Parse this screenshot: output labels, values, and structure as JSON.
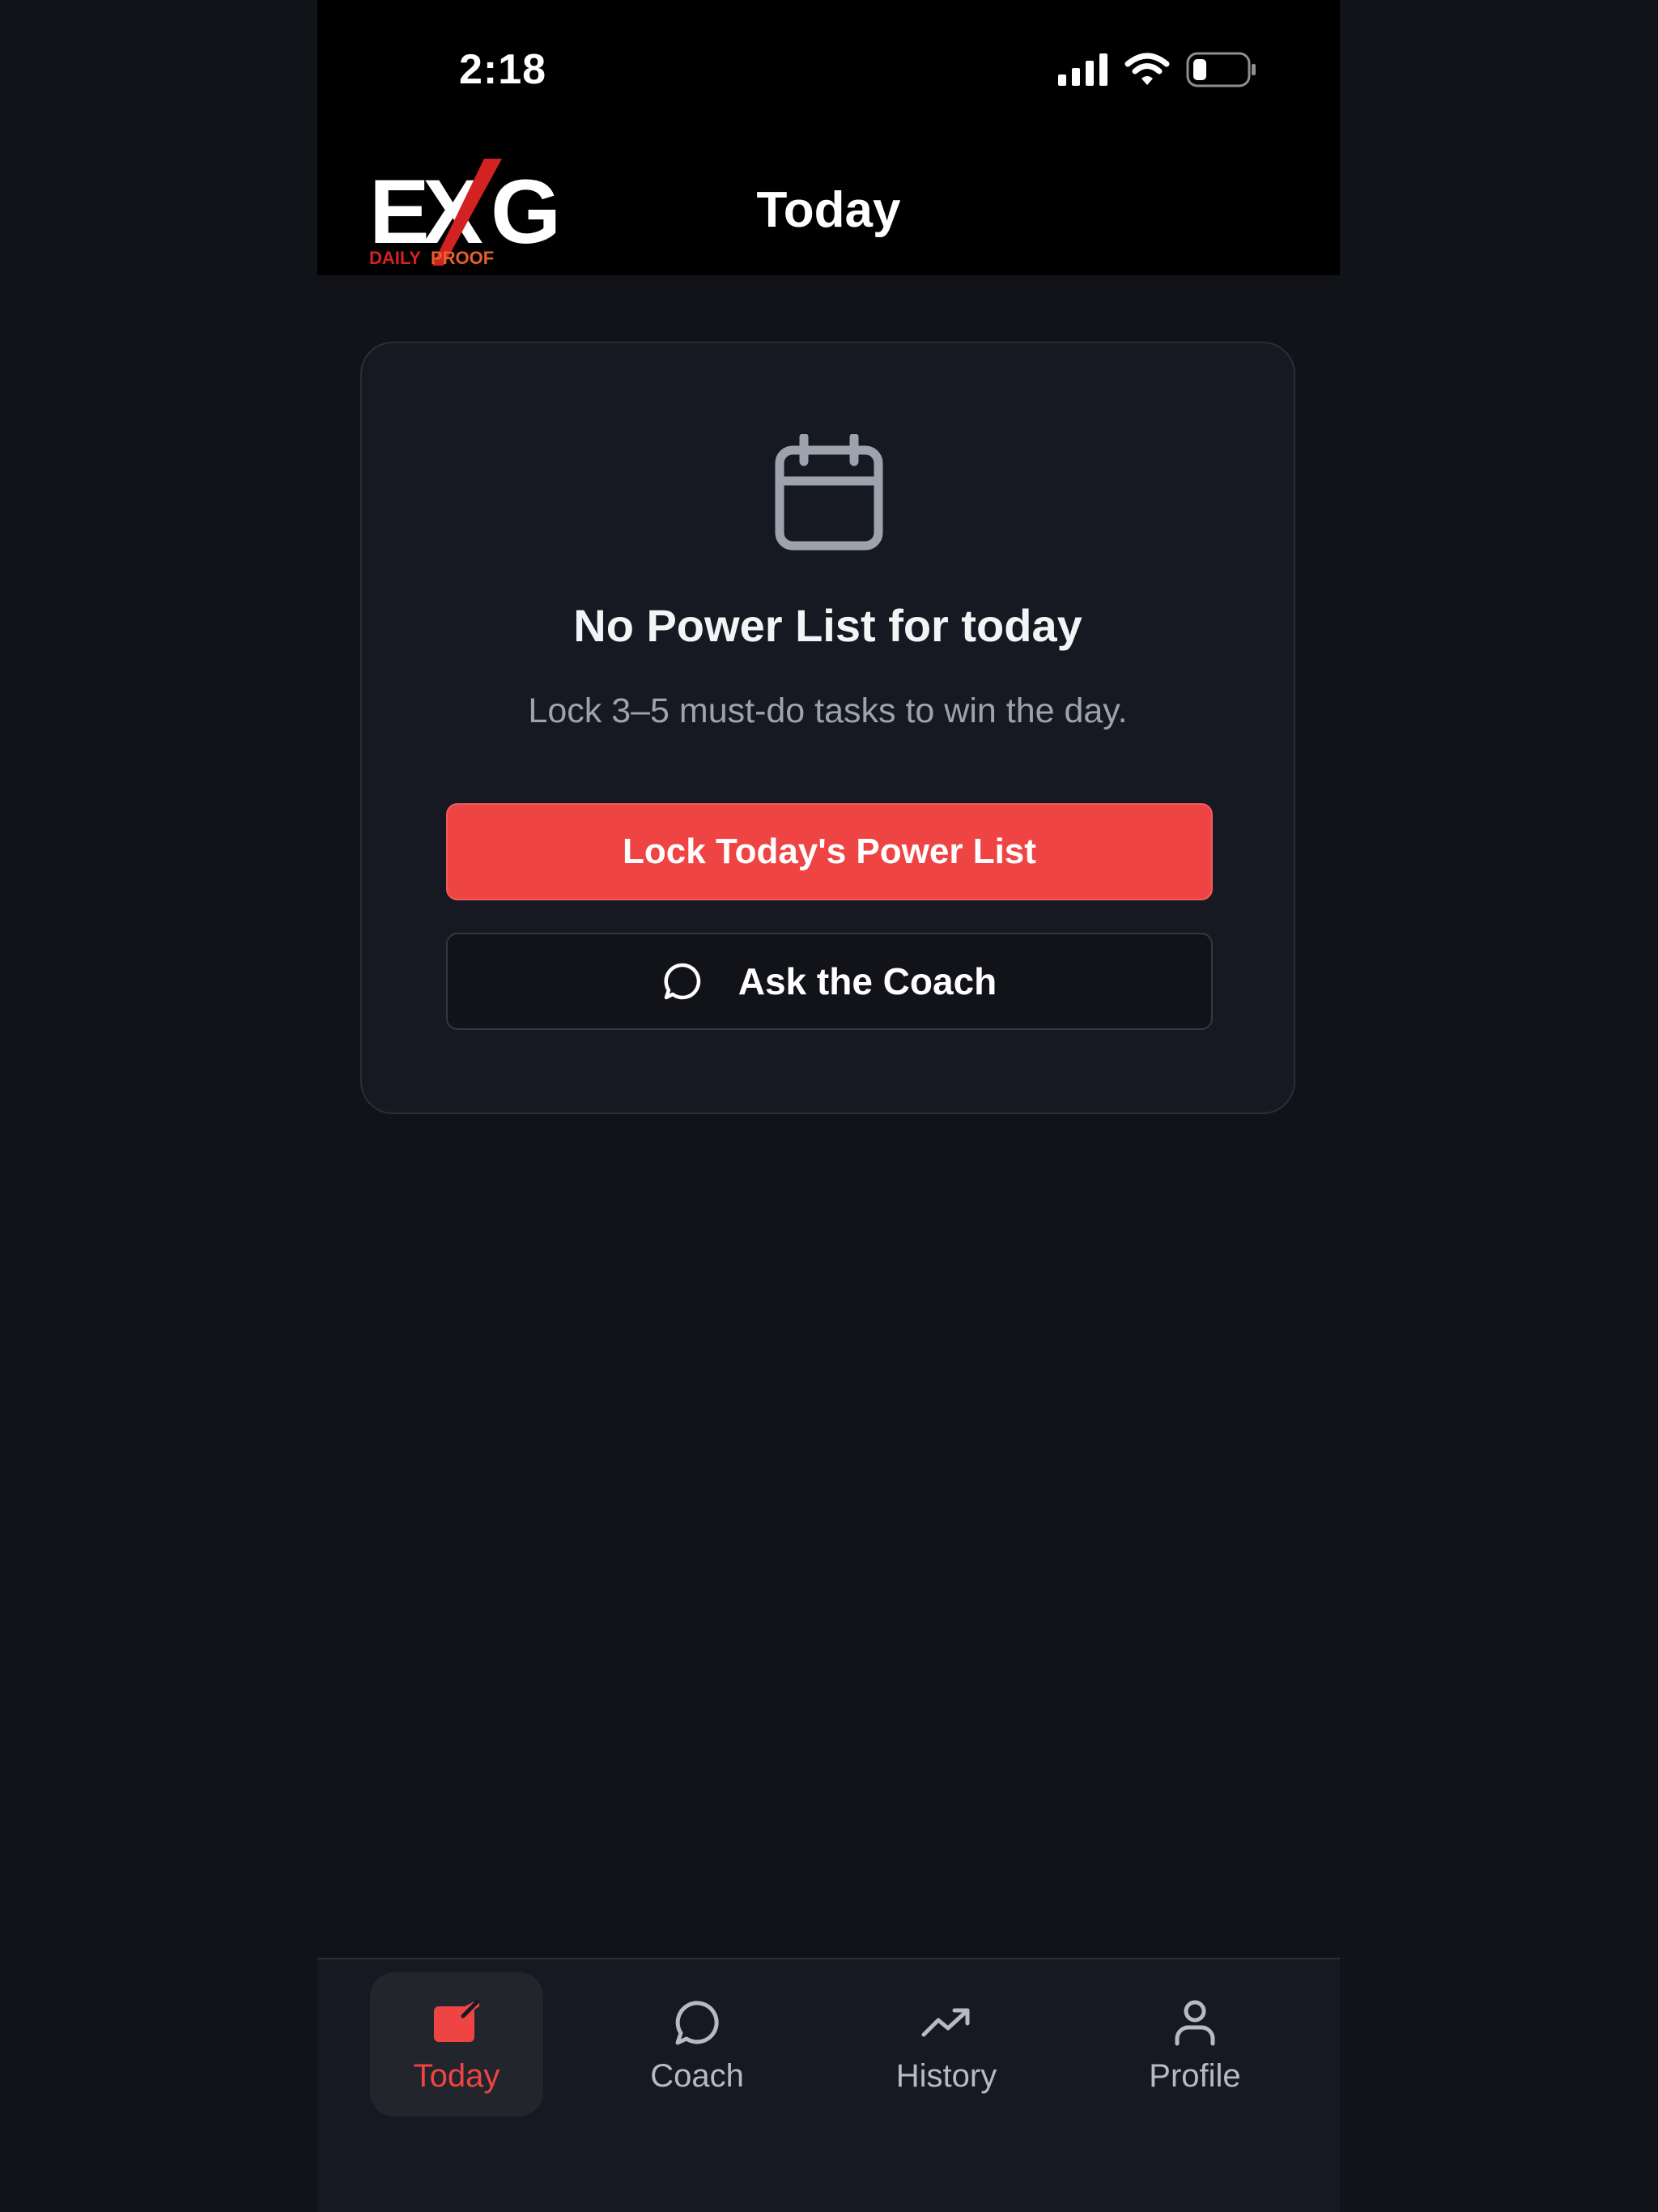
{
  "status_bar": {
    "time": "2:18"
  },
  "header": {
    "logo_text": "EXG",
    "logo_tagline_1": "DAILY",
    "logo_tagline_2": "PROOF",
    "title": "Today"
  },
  "empty_state": {
    "icon": "calendar-icon",
    "title": "No Power List for today",
    "subtitle": "Lock 3–5 must-do tasks to win the day.",
    "primary_button_label": "Lock Today's Power List",
    "secondary_button_label": "Ask the Coach",
    "secondary_button_icon": "chat-bubble-icon"
  },
  "tab_bar": {
    "active_tab": "Today",
    "tabs": [
      {
        "label": "Today",
        "icon": "today-icon"
      },
      {
        "label": "Coach",
        "icon": "chat-bubble-icon"
      },
      {
        "label": "History",
        "icon": "trending-up-icon"
      },
      {
        "label": "Profile",
        "icon": "user-icon"
      }
    ]
  },
  "colors": {
    "accent": "#ef4444",
    "background": "#121318",
    "card": "#171922",
    "header": "#000000",
    "muted_text": "#9ca3af"
  }
}
